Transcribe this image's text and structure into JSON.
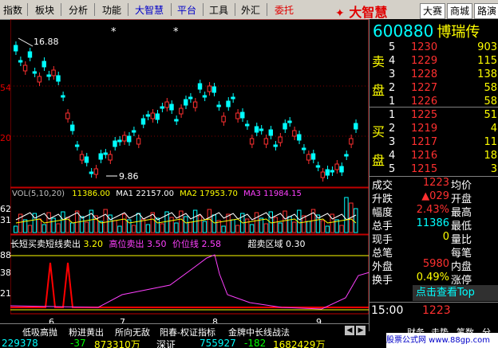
{
  "menu": {
    "items": [
      "指数",
      "板块",
      "分析",
      "功能",
      "大智慧",
      "平台",
      "工具",
      "外汇",
      "委托"
    ],
    "logo": "大智慧",
    "buttons": [
      "大赛",
      "商城",
      "路演"
    ]
  },
  "left_axis": {
    "price_ticks": [
      "54",
      "20"
    ],
    "lower_ticks": [
      "62",
      "31",
      "88",
      "38",
      "21"
    ]
  },
  "chart": {
    "high_label": "16.88",
    "low_label": "9.86",
    "markers": [
      "*",
      "*"
    ],
    "date_ticks": [
      "6",
      "7",
      "8",
      "9"
    ]
  },
  "vol_line": {
    "prefix": "VOL(5,10,20)",
    "vol": "11386.00",
    "ma1_label": "MA1",
    "ma1": "22157.00",
    "ma2_label": "MA2",
    "ma2": "17953.70",
    "ma3_label": "MA3",
    "ma3": "11984.15"
  },
  "indicator_line": {
    "name": "长短买卖短线卖出",
    "v1": "3.20",
    "name2": "高位卖出",
    "v2": "3.50",
    "name3": "价位线",
    "v3": "2.58",
    "name4": "超卖区域",
    "v4": "0.30"
  },
  "stock": {
    "code": "600880",
    "name": "博瑞传"
  },
  "sell_orders": [
    {
      "level": "5",
      "price": "1230",
      "vol": "903"
    },
    {
      "level": "4",
      "price": "1229",
      "vol": "115"
    },
    {
      "level": "3",
      "price": "1228",
      "vol": "138"
    },
    {
      "level": "2",
      "price": "1227",
      "vol": "58"
    },
    {
      "level": "1",
      "price": "1226",
      "vol": "58"
    }
  ],
  "buy_orders": [
    {
      "level": "1",
      "price": "1225",
      "vol": "51"
    },
    {
      "level": "2",
      "price": "1219",
      "vol": "4"
    },
    {
      "level": "3",
      "price": "1217",
      "vol": "11"
    },
    {
      "level": "4",
      "price": "1216",
      "vol": "18"
    },
    {
      "level": "5",
      "price": "1215",
      "vol": "3"
    }
  ],
  "sell_label": [
    "卖",
    "盘"
  ],
  "buy_label": [
    "买",
    "盘"
  ],
  "stats": [
    {
      "label": "成交",
      "value": "1223",
      "label2": "均价",
      "value2": ""
    },
    {
      "label": "升跌",
      "value": "▲029",
      "label2": "开盘",
      "value2": ""
    },
    {
      "label": "幅度",
      "value": "2.43%",
      "label2": "最高",
      "value2": ""
    },
    {
      "label": "总手",
      "value": "11386",
      "label2": "最低",
      "value2": ""
    },
    {
      "label": "现手",
      "value": "0",
      "label2": "量比",
      "value2": ""
    },
    {
      "label": "总笔",
      "value": "",
      "label2": "每笔",
      "value2": ""
    },
    {
      "label": "外盘",
      "value": "5980",
      "label2": "内盘",
      "value2": ""
    },
    {
      "label": "换手",
      "value": "0.49%",
      "label2": "涨停",
      "value2": ""
    }
  ],
  "promo": "点击查看Top",
  "tick": {
    "time": "15:00",
    "price": "1223"
  },
  "bottom_tabs": [
    "低吸高抛",
    "粉进黄出",
    "所向无敌",
    "阳春-权证指标",
    "金牌中长线战法"
  ],
  "status": [
    "229378",
    "-37",
    "873310万",
    "深证",
    "755927",
    "-182",
    "1682429万"
  ],
  "watermark": "股票公式网 www.88gp.com",
  "right_tabs": [
    "财务",
    "走势",
    "笔数",
    "分"
  ]
}
